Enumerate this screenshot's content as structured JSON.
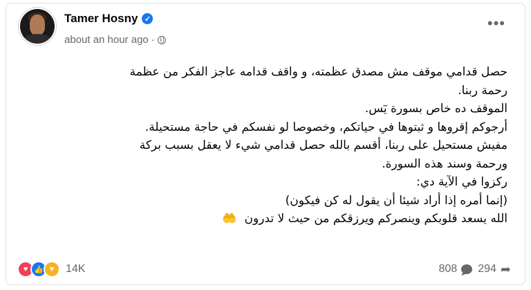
{
  "post": {
    "author": "Tamer Hosny",
    "timestamp": "about an hour ago",
    "separator": "·",
    "more_label": "•••",
    "lines": [
      "حصل قدامي موقف مش مصدق عظمته، و واقف قدامه عاجز الفكر من عظمة",
      "رحمة ربنا.",
      "الموقف ده خاص بسورة يٓس.",
      "أرجوكم إقروها و ثبتوها في حياتكم، وخصوصا لو نفسكم في حاجة مستحيلة.",
      "مفيش مستحيل على ربنا، أقسم بالله حصل قدامي شيء لا يعقل بسبب بركة",
      "ورحمة وسند هذه السورة.",
      "ركزوا في الآية دي:",
      "(إنما أمره إذا أراد شيئا أن يقول له كن فيكون)",
      "الله يسعد قلوبكم وينصركم ويرزقكم من حيث لا تدرون"
    ],
    "praying_hands": "🤲"
  },
  "reactions": {
    "icons": [
      "love-reaction",
      "like-reaction",
      "care-reaction"
    ],
    "count": "14K"
  },
  "stats": {
    "comments": "808",
    "shares": "294"
  }
}
